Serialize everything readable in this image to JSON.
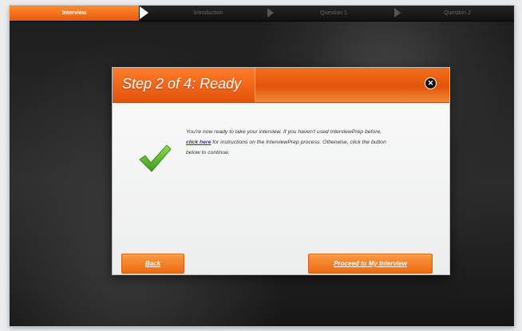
{
  "steps": [
    {
      "label": "Interview",
      "active": true
    },
    {
      "label": "Introduction",
      "active": false
    },
    {
      "label": "Question 1",
      "active": false
    },
    {
      "label": "Question 2",
      "active": false
    }
  ],
  "modal": {
    "title": "Step 2 of 4: Ready",
    "close_icon": "close-icon",
    "check_icon": "checkmark-icon",
    "message_before": "You're now ready to take your interview. If you haven't used InterviewPrep before, ",
    "link_text": "click here",
    "message_after": " for instructions on the InterviewPrep process. Otherwise, click the button below to continue.",
    "back_label": "Back",
    "proceed_label": "Proceed to My Interview"
  },
  "colors": {
    "accent": "#f0621a",
    "link": "#3a25b8",
    "check": "#5ab52a"
  }
}
